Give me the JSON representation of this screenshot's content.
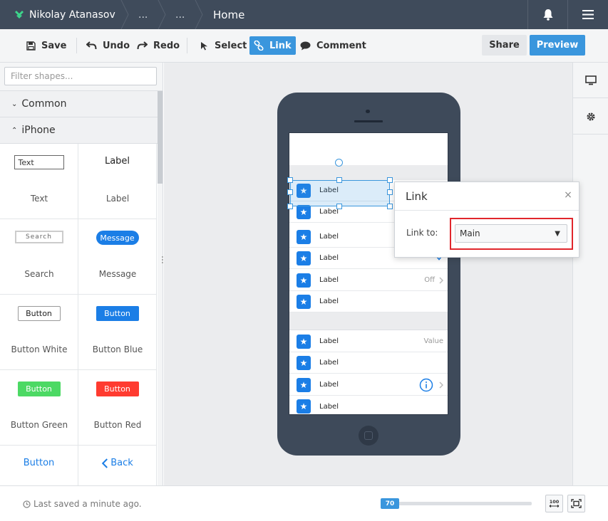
{
  "topbar": {
    "user_name": "Nikolay Atanasov",
    "crumb_1": "...",
    "crumb_2": "...",
    "current_page": "Home"
  },
  "toolbar": {
    "save": "Save",
    "undo": "Undo",
    "redo": "Redo",
    "select": "Select",
    "link": "Link",
    "comment": "Comment",
    "share": "Share",
    "preview": "Preview"
  },
  "left_panel": {
    "filter_placeholder": "Filter shapes...",
    "section_common": "Common",
    "section_iphone": "iPhone",
    "shapes": [
      {
        "preview": "Text",
        "caption": "Text"
      },
      {
        "preview": "Label",
        "caption": "Label"
      },
      {
        "preview": "Search",
        "caption": "Search"
      },
      {
        "preview": "Message",
        "caption": "Message"
      },
      {
        "preview": "Button",
        "caption": "Button White"
      },
      {
        "preview": "Button",
        "caption": "Button Blue"
      },
      {
        "preview": "Button",
        "caption": "Button Green"
      },
      {
        "preview": "Button",
        "caption": "Button Red"
      },
      {
        "preview": "Button",
        "caption": ""
      },
      {
        "preview": "Back",
        "caption": ""
      }
    ]
  },
  "phone": {
    "group1": [
      {
        "label": "Label",
        "right": ""
      },
      {
        "label": "Label",
        "right": ""
      },
      {
        "label": "Label",
        "right": ""
      },
      {
        "label": "Label",
        "right": ""
      },
      {
        "label": "Label",
        "right": "Off"
      },
      {
        "label": "Label",
        "right": ""
      }
    ],
    "group2": [
      {
        "label": "Label",
        "right": "Value"
      },
      {
        "label": "Label",
        "right": ""
      },
      {
        "label": "Label",
        "right": ""
      },
      {
        "label": "Label",
        "right": ""
      }
    ]
  },
  "link_popup": {
    "title": "Link",
    "close": "×",
    "link_to_label": "Link to:",
    "selected_value": "Main"
  },
  "status": {
    "last_saved": "Last saved a minute ago.",
    "zoom_value": "70",
    "zoom_fraction": 0.12,
    "zoom_100_label": "100"
  },
  "colors": {
    "accent": "#3a96dd",
    "topbar": "#3f4b5b",
    "highlight": "#e0262c",
    "star_blue": "#1b7ee6"
  }
}
